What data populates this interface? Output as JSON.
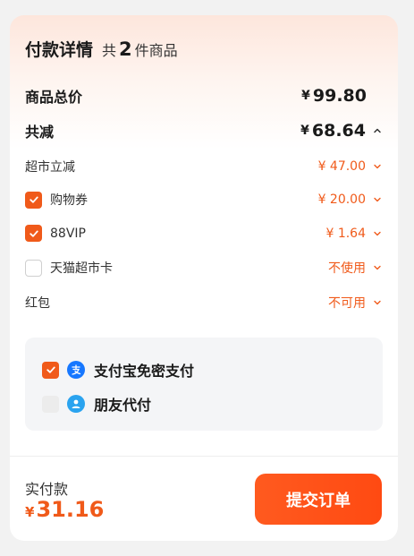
{
  "header": {
    "title": "付款详情",
    "count_prefix": "共",
    "count": "2",
    "count_suffix": "件商品"
  },
  "summary": {
    "total_label": "商品总价",
    "total_currency": "¥",
    "total_value": "99.80",
    "discount_label": "共减",
    "discount_currency": "¥",
    "discount_value": "68.64"
  },
  "discount_items": [
    {
      "label": "超市立减",
      "value": "¥ 47.00",
      "checkbox": "none"
    },
    {
      "label": "购物券",
      "value": "¥ 20.00",
      "checkbox": "checked"
    },
    {
      "label": "88VIP",
      "value": "¥ 1.64",
      "checkbox": "checked"
    },
    {
      "label": "天猫超市卡",
      "value": "不使用",
      "checkbox": "unchecked"
    },
    {
      "label": "红包",
      "value": "不可用",
      "checkbox": "none"
    }
  ],
  "payment": {
    "options": [
      {
        "label": "支付宝免密支付",
        "checked": true,
        "icon": "alipay-icon"
      },
      {
        "label": "朋友代付",
        "checked": false,
        "disabled": true,
        "icon": "friend-pay-icon"
      }
    ]
  },
  "footer": {
    "actual_label": "实付款",
    "actual_currency": "¥",
    "actual_value": "31.16",
    "submit_label": "提交订单"
  },
  "colors": {
    "accent": "#f05a1a",
    "alipay_blue": "#1677ff",
    "button": "#ff4a12"
  }
}
